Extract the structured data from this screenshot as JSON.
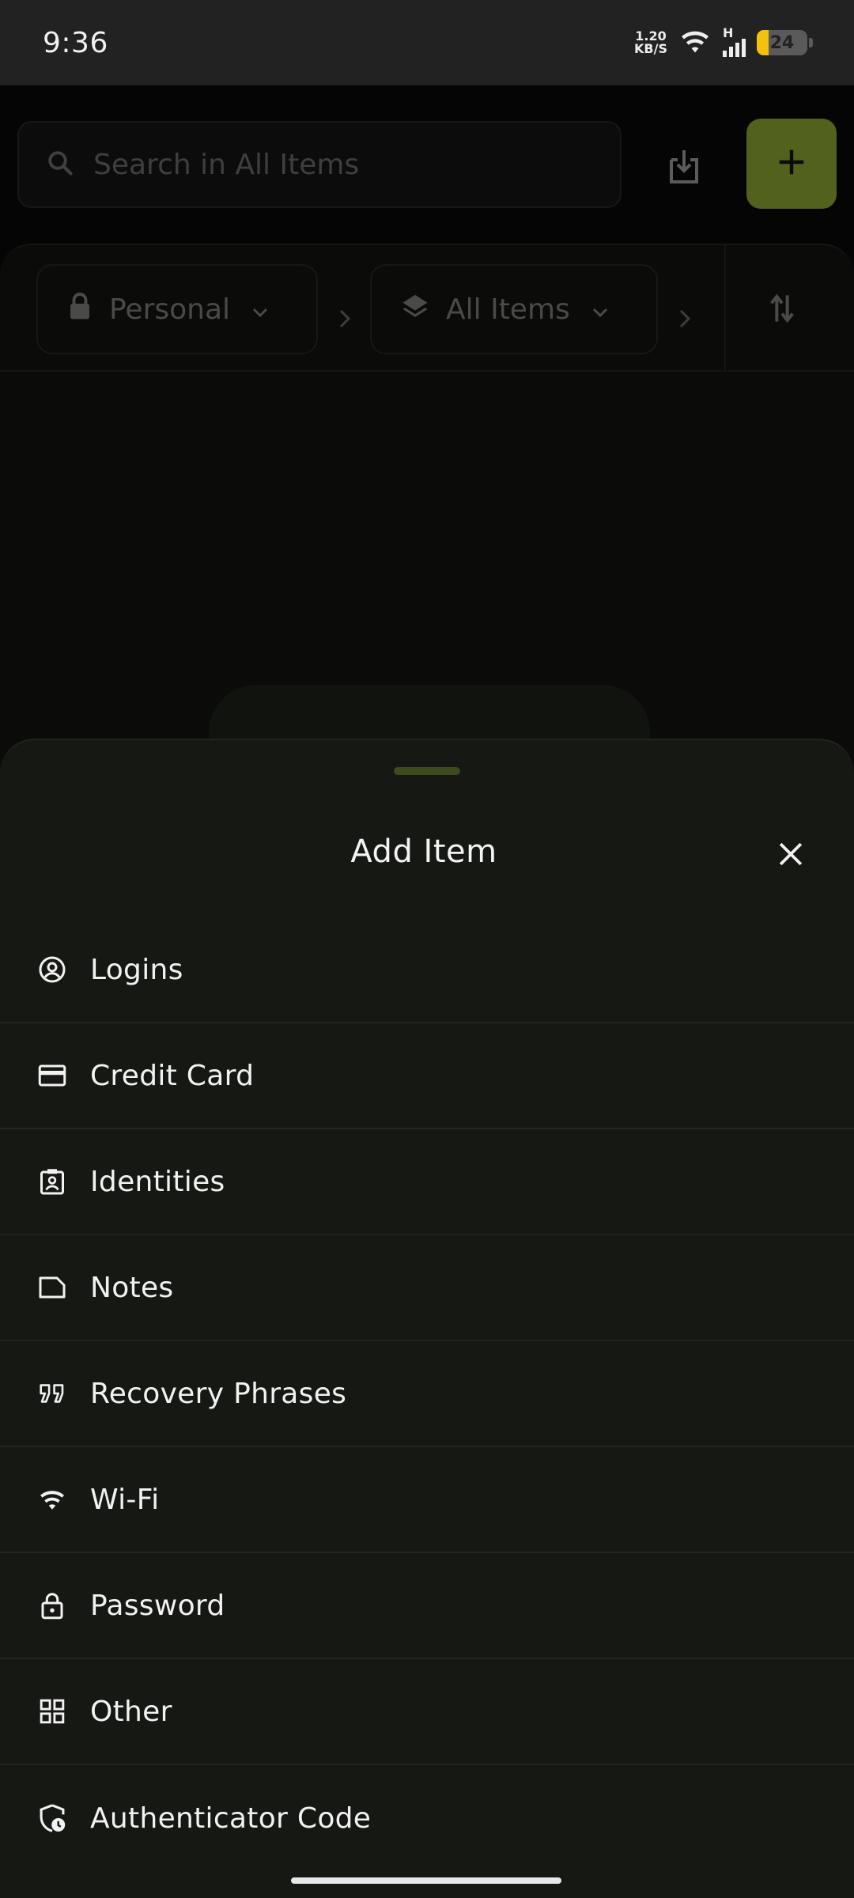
{
  "status_bar": {
    "time": "9:36",
    "net_speed_value": "1.20",
    "net_speed_unit": "KB/S",
    "network_type": "H",
    "battery_level": "24"
  },
  "header": {
    "search_placeholder": "Search in All Items",
    "import_icon": "download-icon",
    "add_icon": "plus-icon",
    "accent_color": "#52611c"
  },
  "filters": {
    "vault_label": "Personal",
    "category_label": "All Items"
  },
  "sheet": {
    "title": "Add Item",
    "items": [
      {
        "label": "Logins",
        "icon": "user-circle-icon"
      },
      {
        "label": "Credit Card",
        "icon": "credit-card-icon"
      },
      {
        "label": "Identities",
        "icon": "id-badge-icon"
      },
      {
        "label": "Notes",
        "icon": "note-icon"
      },
      {
        "label": "Recovery Phrases",
        "icon": "quote-icon"
      },
      {
        "label": "Wi-Fi",
        "icon": "wifi-icon"
      },
      {
        "label": "Password",
        "icon": "lock-icon"
      },
      {
        "label": "Other",
        "icon": "grid-icon"
      },
      {
        "label": "Authenticator Code",
        "icon": "shield-clock-icon"
      }
    ]
  }
}
